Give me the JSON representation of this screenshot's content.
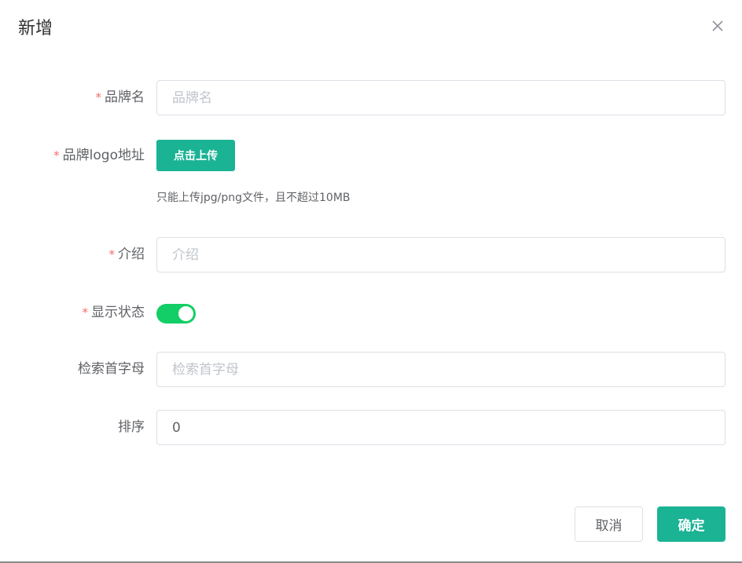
{
  "dialog": {
    "title": "新增",
    "close_icon": "close-icon"
  },
  "form": {
    "brand_name": {
      "required_mark": "*",
      "label": "品牌名",
      "placeholder": "品牌名",
      "value": ""
    },
    "logo": {
      "required_mark": "*",
      "label": "品牌logo地址",
      "upload_label": "点击上传",
      "tip": "只能上传jpg/png文件，且不超过10MB"
    },
    "intro": {
      "required_mark": "*",
      "label": "介绍",
      "placeholder": "介绍",
      "value": ""
    },
    "show_status": {
      "required_mark": "*",
      "label": "显示状态",
      "on": true,
      "active_color": "#13ce66"
    },
    "first_letter": {
      "label": "检索首字母",
      "placeholder": "检索首字母",
      "value": ""
    },
    "sort": {
      "label": "排序",
      "value": "0"
    }
  },
  "footer": {
    "cancel_label": "取消",
    "confirm_label": "确定"
  },
  "colors": {
    "primary": "#1ab394",
    "required": "#f56c6c"
  }
}
